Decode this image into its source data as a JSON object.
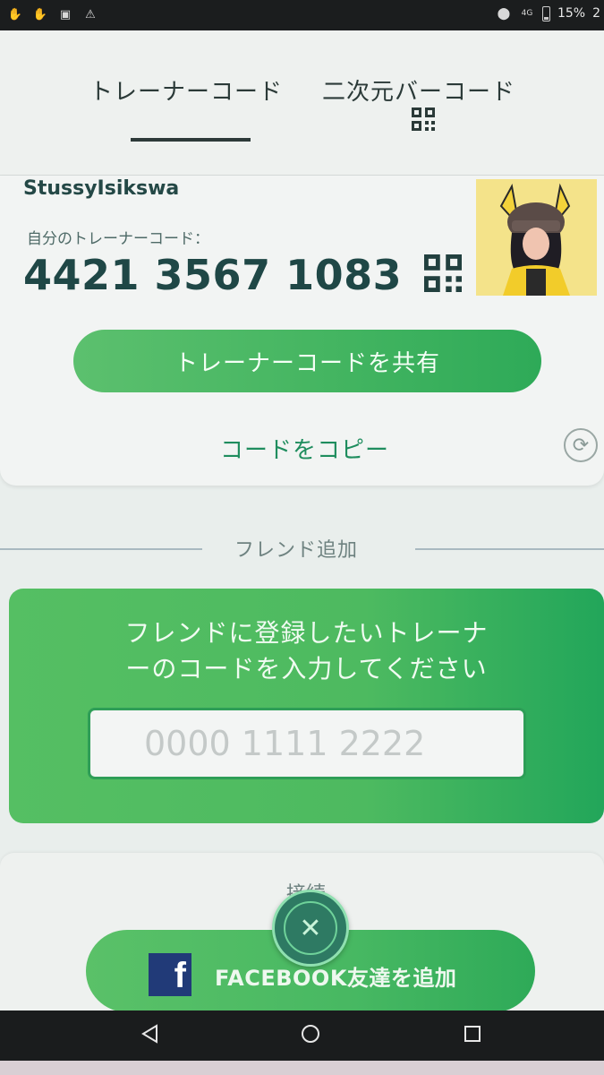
{
  "status_bar": {
    "battery_percent": "15%",
    "time_partial": "2",
    "network": "4G"
  },
  "tabs": [
    {
      "label": "トレーナーコード",
      "active": true
    },
    {
      "label": "二次元バーコード",
      "active": false
    }
  ],
  "profile": {
    "username": "StussyIsikswa",
    "code_label": "自分のトレーナーコード：",
    "trainer_code": "4421 3567 1083",
    "share_label": "トレーナーコードを共有",
    "copy_label": "コードをコピー"
  },
  "add_friend": {
    "section_title": "フレンド追加",
    "instruction_line1": "フレンドに登録したいトレーナ",
    "instruction_line2": "ーのコードを入力してください",
    "input_value": "",
    "input_placeholder": "0000 1111 2222"
  },
  "connect": {
    "section_title": "接続",
    "facebook_label": "FACEBOOK友達を追加"
  },
  "colors": {
    "accent_green": "#4dba60",
    "dark_teal": "#1f4746",
    "facebook_blue": "#213a78"
  },
  "icons": {
    "qr": "qr-code-icon",
    "refresh": "refresh-icon",
    "close": "close-icon",
    "facebook": "facebook-icon"
  }
}
